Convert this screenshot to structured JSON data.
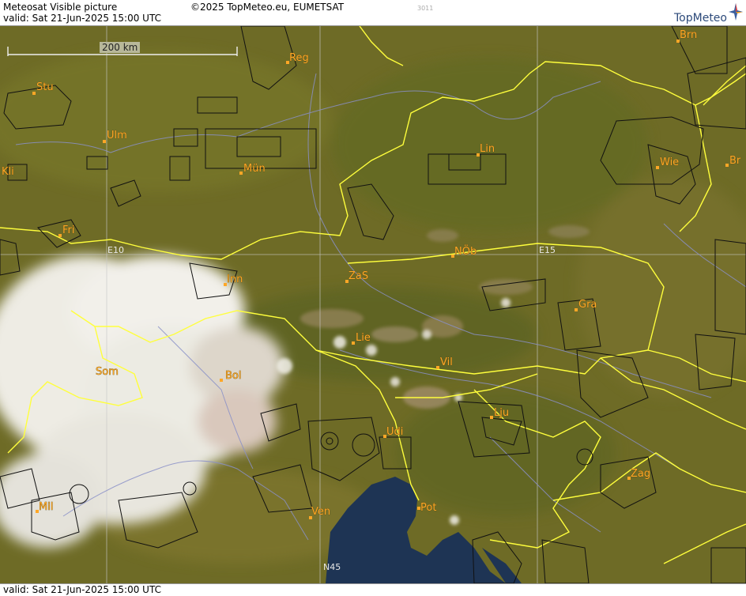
{
  "header": {
    "title": "Meteosat Visible picture",
    "copyright": "©2025 TopMeteo.eu, EUMETSAT",
    "code": "3011",
    "valid": "valid:  Sat  21-Jun-2025  15:00 UTC",
    "logo": "TopMeteo"
  },
  "footer": {
    "valid": "valid:  Sat  21-Jun-2025  15:00 UTC"
  },
  "map": {
    "scale_label": "200 km",
    "grid_labels": [
      "E10",
      "E15",
      "N45"
    ],
    "cities": [
      {
        "name": "Reg"
      },
      {
        "name": "Brn"
      },
      {
        "name": "Stu"
      },
      {
        "name": "Ulm"
      },
      {
        "name": "Lin"
      },
      {
        "name": "Wie"
      },
      {
        "name": "Br"
      },
      {
        "name": "Kli"
      },
      {
        "name": "Mün"
      },
      {
        "name": "Fri"
      },
      {
        "name": "NÖb"
      },
      {
        "name": "Inn"
      },
      {
        "name": "ZaS"
      },
      {
        "name": "Gra"
      },
      {
        "name": "Lie"
      },
      {
        "name": "Vil"
      },
      {
        "name": "Som"
      },
      {
        "name": "Bol"
      },
      {
        "name": "Lju"
      },
      {
        "name": "Udi"
      },
      {
        "name": "Zag"
      },
      {
        "name": "Mil"
      },
      {
        "name": "Ven"
      },
      {
        "name": "Pot"
      }
    ],
    "colors": {
      "land": "#6e6b26",
      "sea": "#1e3454",
      "cloud": "#f2f0ea",
      "border": "#ffff3c",
      "river": "#8a90c8",
      "city": "#ffa726"
    }
  }
}
